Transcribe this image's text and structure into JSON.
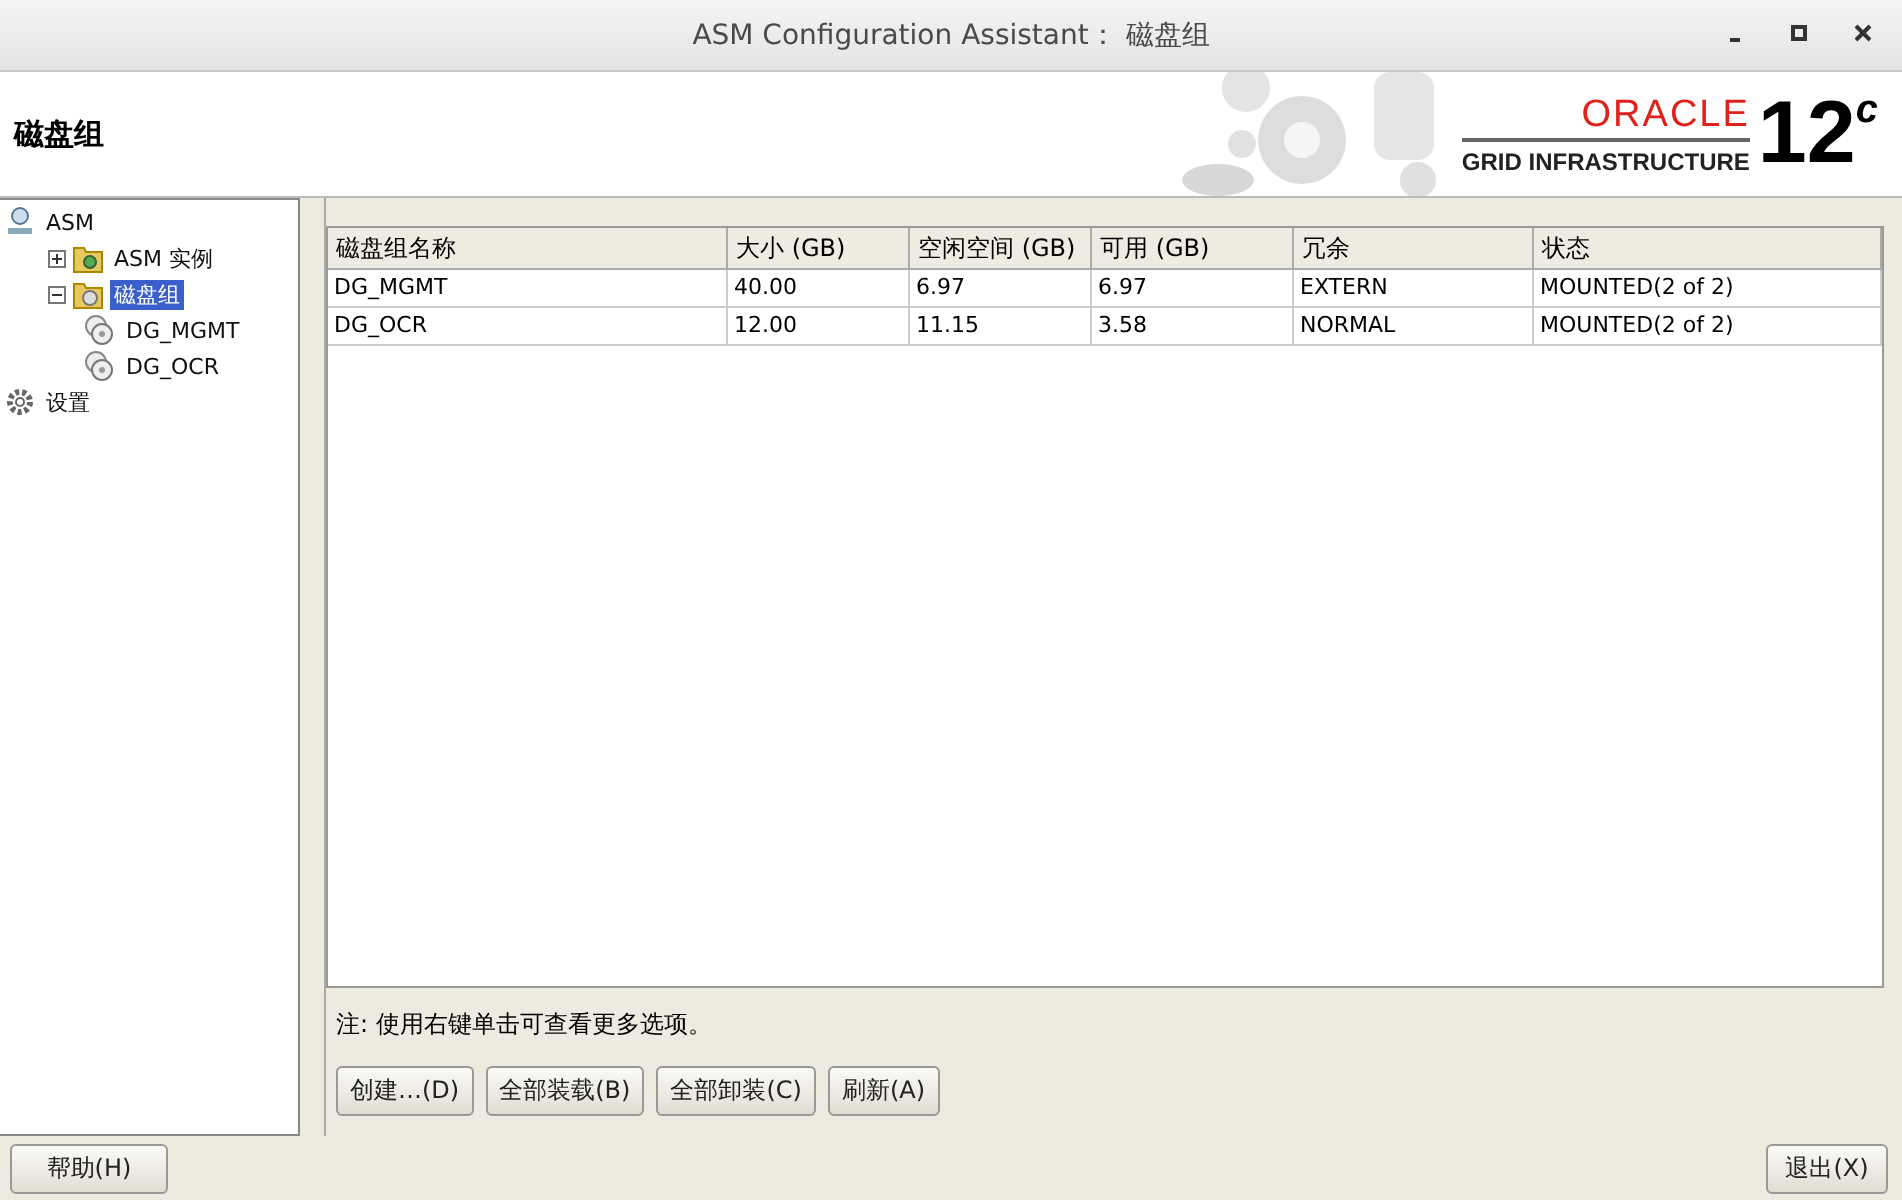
{
  "window": {
    "title": "ASM Configuration Assistant： 磁盘组"
  },
  "header": {
    "title": "磁盘组",
    "logo": {
      "brand": "ORACLE",
      "product": "GRID INFRASTRUCTURE",
      "version": "12",
      "version_suffix": "c"
    }
  },
  "tree": [
    {
      "label": "ASM",
      "kind": "root",
      "selected": false,
      "children": [
        {
          "label": "ASM 实例",
          "kind": "folder-gear",
          "selected": false,
          "expanded": false
        },
        {
          "label": "磁盘组",
          "kind": "folder-disk",
          "selected": true,
          "expanded": true,
          "children": [
            {
              "label": "DG_MGMT",
              "kind": "disk",
              "selected": false
            },
            {
              "label": "DG_OCR",
              "kind": "disk",
              "selected": false
            }
          ]
        }
      ]
    },
    {
      "label": "设置",
      "kind": "gear",
      "selected": false
    }
  ],
  "table": {
    "columns": [
      "磁盘组名称",
      "大小 (GB)",
      "空闲空间 (GB)",
      "可用 (GB)",
      "冗余",
      "状态"
    ],
    "rows": [
      [
        "DG_MGMT",
        "40.00",
        "6.97",
        "6.97",
        "EXTERN",
        "MOUNTED(2 of 2)"
      ],
      [
        "DG_OCR",
        "12.00",
        "11.15",
        "3.58",
        "NORMAL",
        "MOUNTED(2 of 2)"
      ]
    ]
  },
  "note": "注: 使用右键单击可查看更多选项。",
  "actions": [
    "创建…(D)",
    "全部装载(B)",
    "全部卸装(C)",
    "刷新(A)"
  ],
  "footer": {
    "help": "帮助(H)",
    "exit": "退出(X)"
  }
}
